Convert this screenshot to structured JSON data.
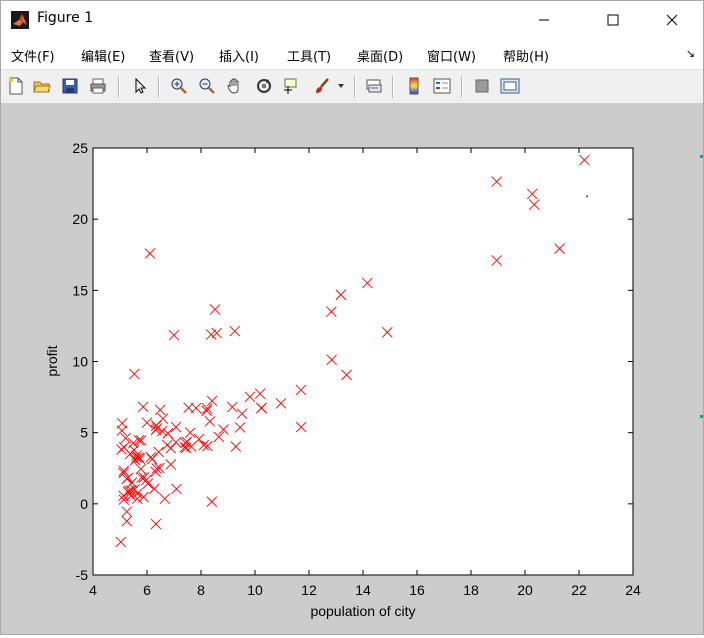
{
  "window": {
    "title": "Figure 1"
  },
  "menu": {
    "items": [
      "文件(F)",
      "编辑(E)",
      "查看(V)",
      "插入(I)",
      "工具(T)",
      "桌面(D)",
      "窗口(W)",
      "帮助(H)"
    ]
  },
  "toolbar": {
    "icons": [
      "new-figure-icon",
      "open-file-icon",
      "save-icon",
      "print-icon",
      "pointer-icon",
      "zoom-in-icon",
      "zoom-out-icon",
      "pan-hand-icon",
      "rotate-3d-icon",
      "data-cursor-icon",
      "brush-icon",
      "brush-dropdown-icon",
      "link-plot-icon",
      "colorbar-icon",
      "legend-icon",
      "hide-plot-tools-icon",
      "show-plot-tools-icon"
    ]
  },
  "colors": {
    "marker": "#ff0000",
    "figure_bg": "#cccccc",
    "axes_bg": "#ffffff"
  },
  "chart_data": {
    "type": "scatter",
    "title": "",
    "xlabel": "population of city",
    "ylabel": "profit",
    "xlim": [
      4,
      24
    ],
    "ylim": [
      -5,
      25
    ],
    "xticks": [
      4,
      6,
      8,
      10,
      12,
      14,
      16,
      18,
      20,
      22,
      24
    ],
    "yticks": [
      -5,
      0,
      5,
      10,
      15,
      20,
      25
    ],
    "grid": false,
    "marker": "x",
    "points": [
      {
        "x": 6.11,
        "y": 17.59
      },
      {
        "x": 5.53,
        "y": 9.13
      },
      {
        "x": 8.52,
        "y": 13.66
      },
      {
        "x": 7.0,
        "y": 11.85
      },
      {
        "x": 5.86,
        "y": 6.82
      },
      {
        "x": 8.38,
        "y": 11.89
      },
      {
        "x": 7.48,
        "y": 4.35
      },
      {
        "x": 8.58,
        "y": 12.0
      },
      {
        "x": 6.49,
        "y": 6.6
      },
      {
        "x": 5.05,
        "y": 3.82
      },
      {
        "x": 5.71,
        "y": 3.25
      },
      {
        "x": 14.16,
        "y": 15.51
      },
      {
        "x": 5.73,
        "y": 3.16
      },
      {
        "x": 8.41,
        "y": 7.23
      },
      {
        "x": 5.64,
        "y": 0.72
      },
      {
        "x": 5.38,
        "y": 3.51
      },
      {
        "x": 6.37,
        "y": 5.3
      },
      {
        "x": 5.13,
        "y": 0.56
      },
      {
        "x": 6.43,
        "y": 3.65
      },
      {
        "x": 7.07,
        "y": 5.39
      },
      {
        "x": 6.19,
        "y": 3.14
      },
      {
        "x": 20.27,
        "y": 21.77
      },
      {
        "x": 5.49,
        "y": 4.26
      },
      {
        "x": 6.33,
        "y": 5.19
      },
      {
        "x": 5.56,
        "y": 3.08
      },
      {
        "x": 18.95,
        "y": 22.64
      },
      {
        "x": 12.83,
        "y": 13.5
      },
      {
        "x": 10.96,
        "y": 7.05
      },
      {
        "x": 13.18,
        "y": 14.69
      },
      {
        "x": 22.2,
        "y": 24.15
      },
      {
        "x": 5.25,
        "y": -1.22
      },
      {
        "x": 6.59,
        "y": 5.99
      },
      {
        "x": 9.25,
        "y": 12.13
      },
      {
        "x": 5.89,
        "y": 1.85
      },
      {
        "x": 8.21,
        "y": 6.54
      },
      {
        "x": 7.93,
        "y": 4.56
      },
      {
        "x": 8.1,
        "y": 4.12
      },
      {
        "x": 5.61,
        "y": 3.39
      },
      {
        "x": 12.84,
        "y": 10.12
      },
      {
        "x": 6.35,
        "y": 5.5
      },
      {
        "x": 5.41,
        "y": 0.56
      },
      {
        "x": 6.88,
        "y": 3.91
      },
      {
        "x": 11.71,
        "y": 5.39
      },
      {
        "x": 5.77,
        "y": 2.44
      },
      {
        "x": 7.82,
        "y": 6.73
      },
      {
        "x": 7.09,
        "y": 1.05
      },
      {
        "x": 5.07,
        "y": 5.14
      },
      {
        "x": 5.8,
        "y": 1.84
      },
      {
        "x": 11.7,
        "y": 8.0
      },
      {
        "x": 5.54,
        "y": 1.02
      },
      {
        "x": 7.54,
        "y": 6.75
      },
      {
        "x": 5.31,
        "y": 1.84
      },
      {
        "x": 7.42,
        "y": 4.29
      },
      {
        "x": 7.6,
        "y": 5.0
      },
      {
        "x": 6.03,
        "y": 1.42
      },
      {
        "x": 6.33,
        "y": -1.42
      },
      {
        "x": 6.36,
        "y": 2.48
      },
      {
        "x": 5.21,
        "y": 4.61
      },
      {
        "x": 5.15,
        "y": 3.97
      },
      {
        "x": 5.62,
        "y": 3.24
      },
      {
        "x": 8.4,
        "y": 0.15
      },
      {
        "x": 5.14,
        "y": 2.32
      },
      {
        "x": 6.75,
        "y": 4.13
      },
      {
        "x": 5.34,
        "y": 0.92
      },
      {
        "x": 6.46,
        "y": 2.51
      },
      {
        "x": 6.14,
        "y": 3.28
      },
      {
        "x": 9.45,
        "y": 5.37
      },
      {
        "x": 5.87,
        "y": 0.48
      },
      {
        "x": 7.45,
        "y": 3.93
      },
      {
        "x": 9.81,
        "y": 7.52
      },
      {
        "x": 5.7,
        "y": 4.46
      },
      {
        "x": 5.03,
        "y": -2.68
      },
      {
        "x": 9.29,
        "y": 4.02
      },
      {
        "x": 8.83,
        "y": 5.22
      },
      {
        "x": 6.66,
        "y": 0.36
      },
      {
        "x": 5.42,
        "y": 0.94
      },
      {
        "x": 5.64,
        "y": 0.36
      },
      {
        "x": 6.27,
        "y": 1.06
      },
      {
        "x": 5.44,
        "y": 1.49
      },
      {
        "x": 5.52,
        "y": 3.79
      },
      {
        "x": 5.3,
        "y": 0.84
      },
      {
        "x": 8.66,
        "y": 4.7
      },
      {
        "x": 8.23,
        "y": 6.7
      },
      {
        "x": 10.24,
        "y": 6.72
      },
      {
        "x": 7.4,
        "y": 3.97
      },
      {
        "x": 7.64,
        "y": 4.02
      },
      {
        "x": 8.33,
        "y": 5.8
      },
      {
        "x": 5.14,
        "y": 0.29
      },
      {
        "x": 10.24,
        "y": 6.74
      },
      {
        "x": 13.39,
        "y": 9.06
      },
      {
        "x": 5.25,
        "y": 1.75
      },
      {
        "x": 14.9,
        "y": 12.05
      },
      {
        "x": 6.0,
        "y": 5.7
      },
      {
        "x": 21.28,
        "y": 17.93
      },
      {
        "x": 20.34,
        "y": 21.03
      },
      {
        "x": 18.95,
        "y": 17.1
      },
      {
        "x": 5.08,
        "y": 5.66
      },
      {
        "x": 9.16,
        "y": 6.8
      },
      {
        "x": 10.19,
        "y": 7.74
      },
      {
        "x": 5.13,
        "y": 2.17
      },
      {
        "x": 5.78,
        "y": 4.45
      },
      {
        "x": 6.88,
        "y": 2.77
      },
      {
        "x": 7.07,
        "y": 4.32
      },
      {
        "x": 8.24,
        "y": 4.06
      },
      {
        "x": 6.32,
        "y": 2.25
      },
      {
        "x": 6.77,
        "y": 4.95
      },
      {
        "x": 9.52,
        "y": 6.33
      },
      {
        "x": 5.25,
        "y": -0.55
      },
      {
        "x": 5.97,
        "y": 1.67
      },
      {
        "x": 6.34,
        "y": 5.5
      },
      {
        "x": 6.56,
        "y": 5.1
      }
    ],
    "markers_dot": [
      {
        "x": 22.3,
        "y": 21.6
      }
    ]
  }
}
